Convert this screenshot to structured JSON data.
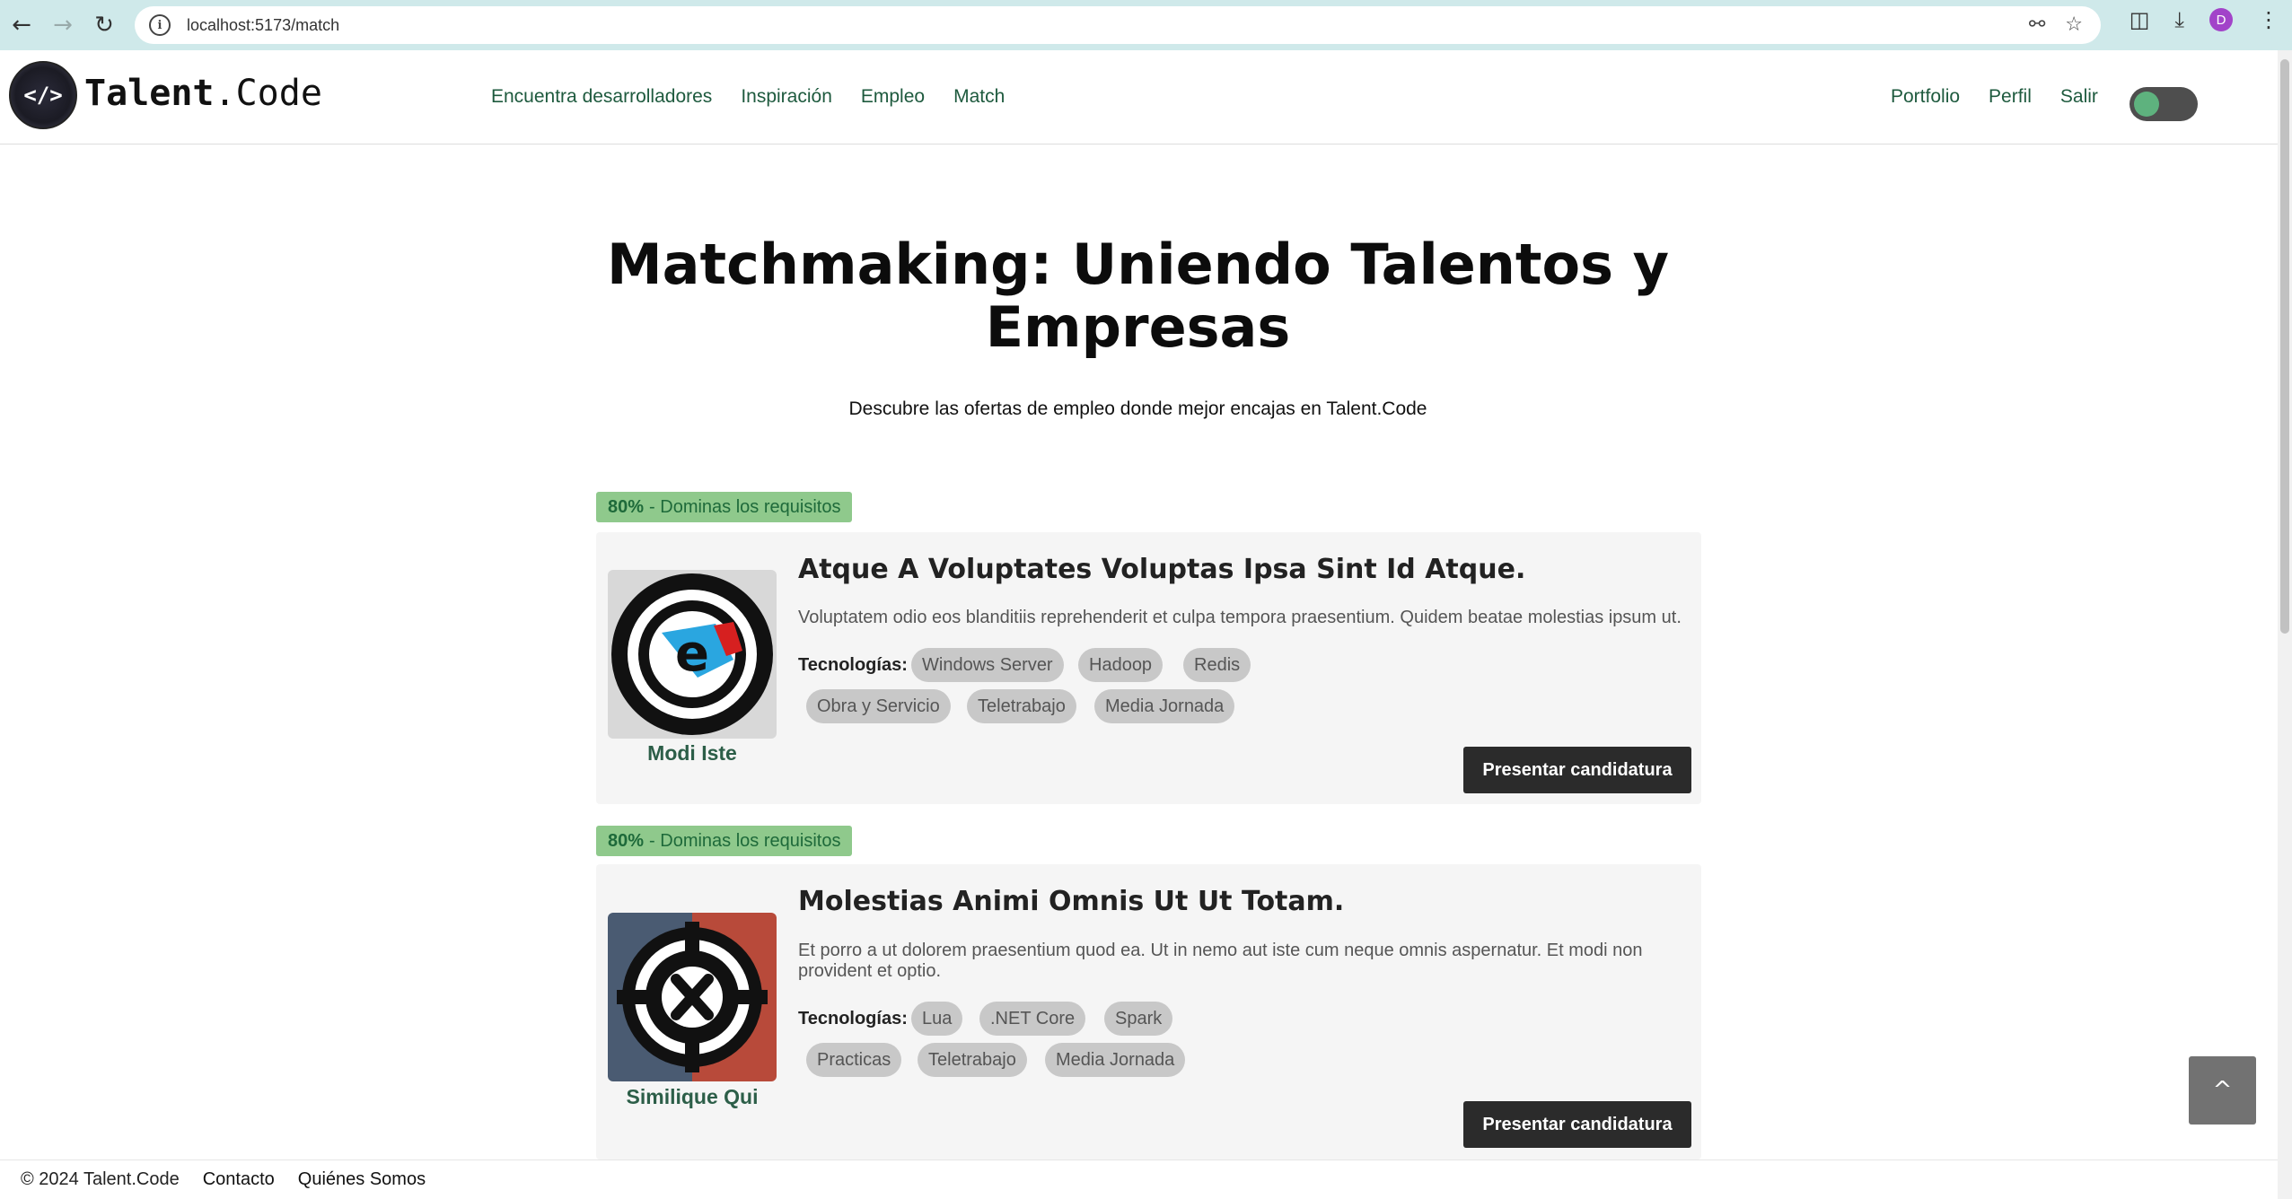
{
  "browser": {
    "url": "localhost:5173/match",
    "profile_initial": "D"
  },
  "site": {
    "brand_bold": "Talent",
    "brand_rest": ".Code",
    "logo_text": "</>",
    "nav": [
      "Encuentra desarrolladores",
      "Inspiración",
      "Empleo",
      "Match"
    ],
    "user_nav": [
      "Portfolio",
      "Perfil",
      "Salir"
    ],
    "theme_toggle_on": true
  },
  "hero": {
    "title": "Matchmaking: Uniendo Talentos y Empresas",
    "subtitle": "Descubre las ofertas de empleo donde mejor encajas en Talent.Code"
  },
  "jobs": [
    {
      "match_percent": "80%",
      "match_text": "- Dominas los requisitos",
      "company": "Modi Iste",
      "title": "Atque A Voluptates Voluptas Ipsa Sint Id Atque.",
      "description": "Voluptatem odio eos blanditiis reprehenderit et culpa tempora praesentium. Quidem beatae molestias ipsum ut.",
      "tech_label": "Tecnologías:",
      "tags": [
        "Windows Server",
        "Hadoop",
        "Redis",
        "Obra y Servicio",
        "Teletrabajo",
        "Media Jornada"
      ],
      "apply_label": "Presentar candidatura"
    },
    {
      "match_percent": "80%",
      "match_text": "- Dominas los requisitos",
      "company": "Similique Qui",
      "title": "Molestias Animi Omnis Ut Ut Totam.",
      "description": "Et porro a ut dolorem praesentium quod ea. Ut in nemo aut iste cum neque omnis aspernatur. Et modi non provident et optio.",
      "tech_label": "Tecnologías:",
      "tags": [
        "Lua",
        ".NET Core",
        "Spark",
        "Practicas",
        "Teletrabajo",
        "Media Jornada"
      ],
      "apply_label": "Presentar candidatura"
    }
  ],
  "scroll_top_label": "^",
  "footer": {
    "copyright": "© 2024 Talent.Code",
    "links": [
      "Contacto",
      "Quiénes Somos"
    ]
  },
  "icons": {
    "back": "arrow-left-icon",
    "forward": "arrow-right-icon",
    "reload": "reload-icon",
    "site_info": "info-icon",
    "password": "key-icon",
    "bookmark": "star-icon",
    "extensions": "puzzle-icon",
    "download": "download-icon",
    "menu": "kebab-menu-icon"
  }
}
